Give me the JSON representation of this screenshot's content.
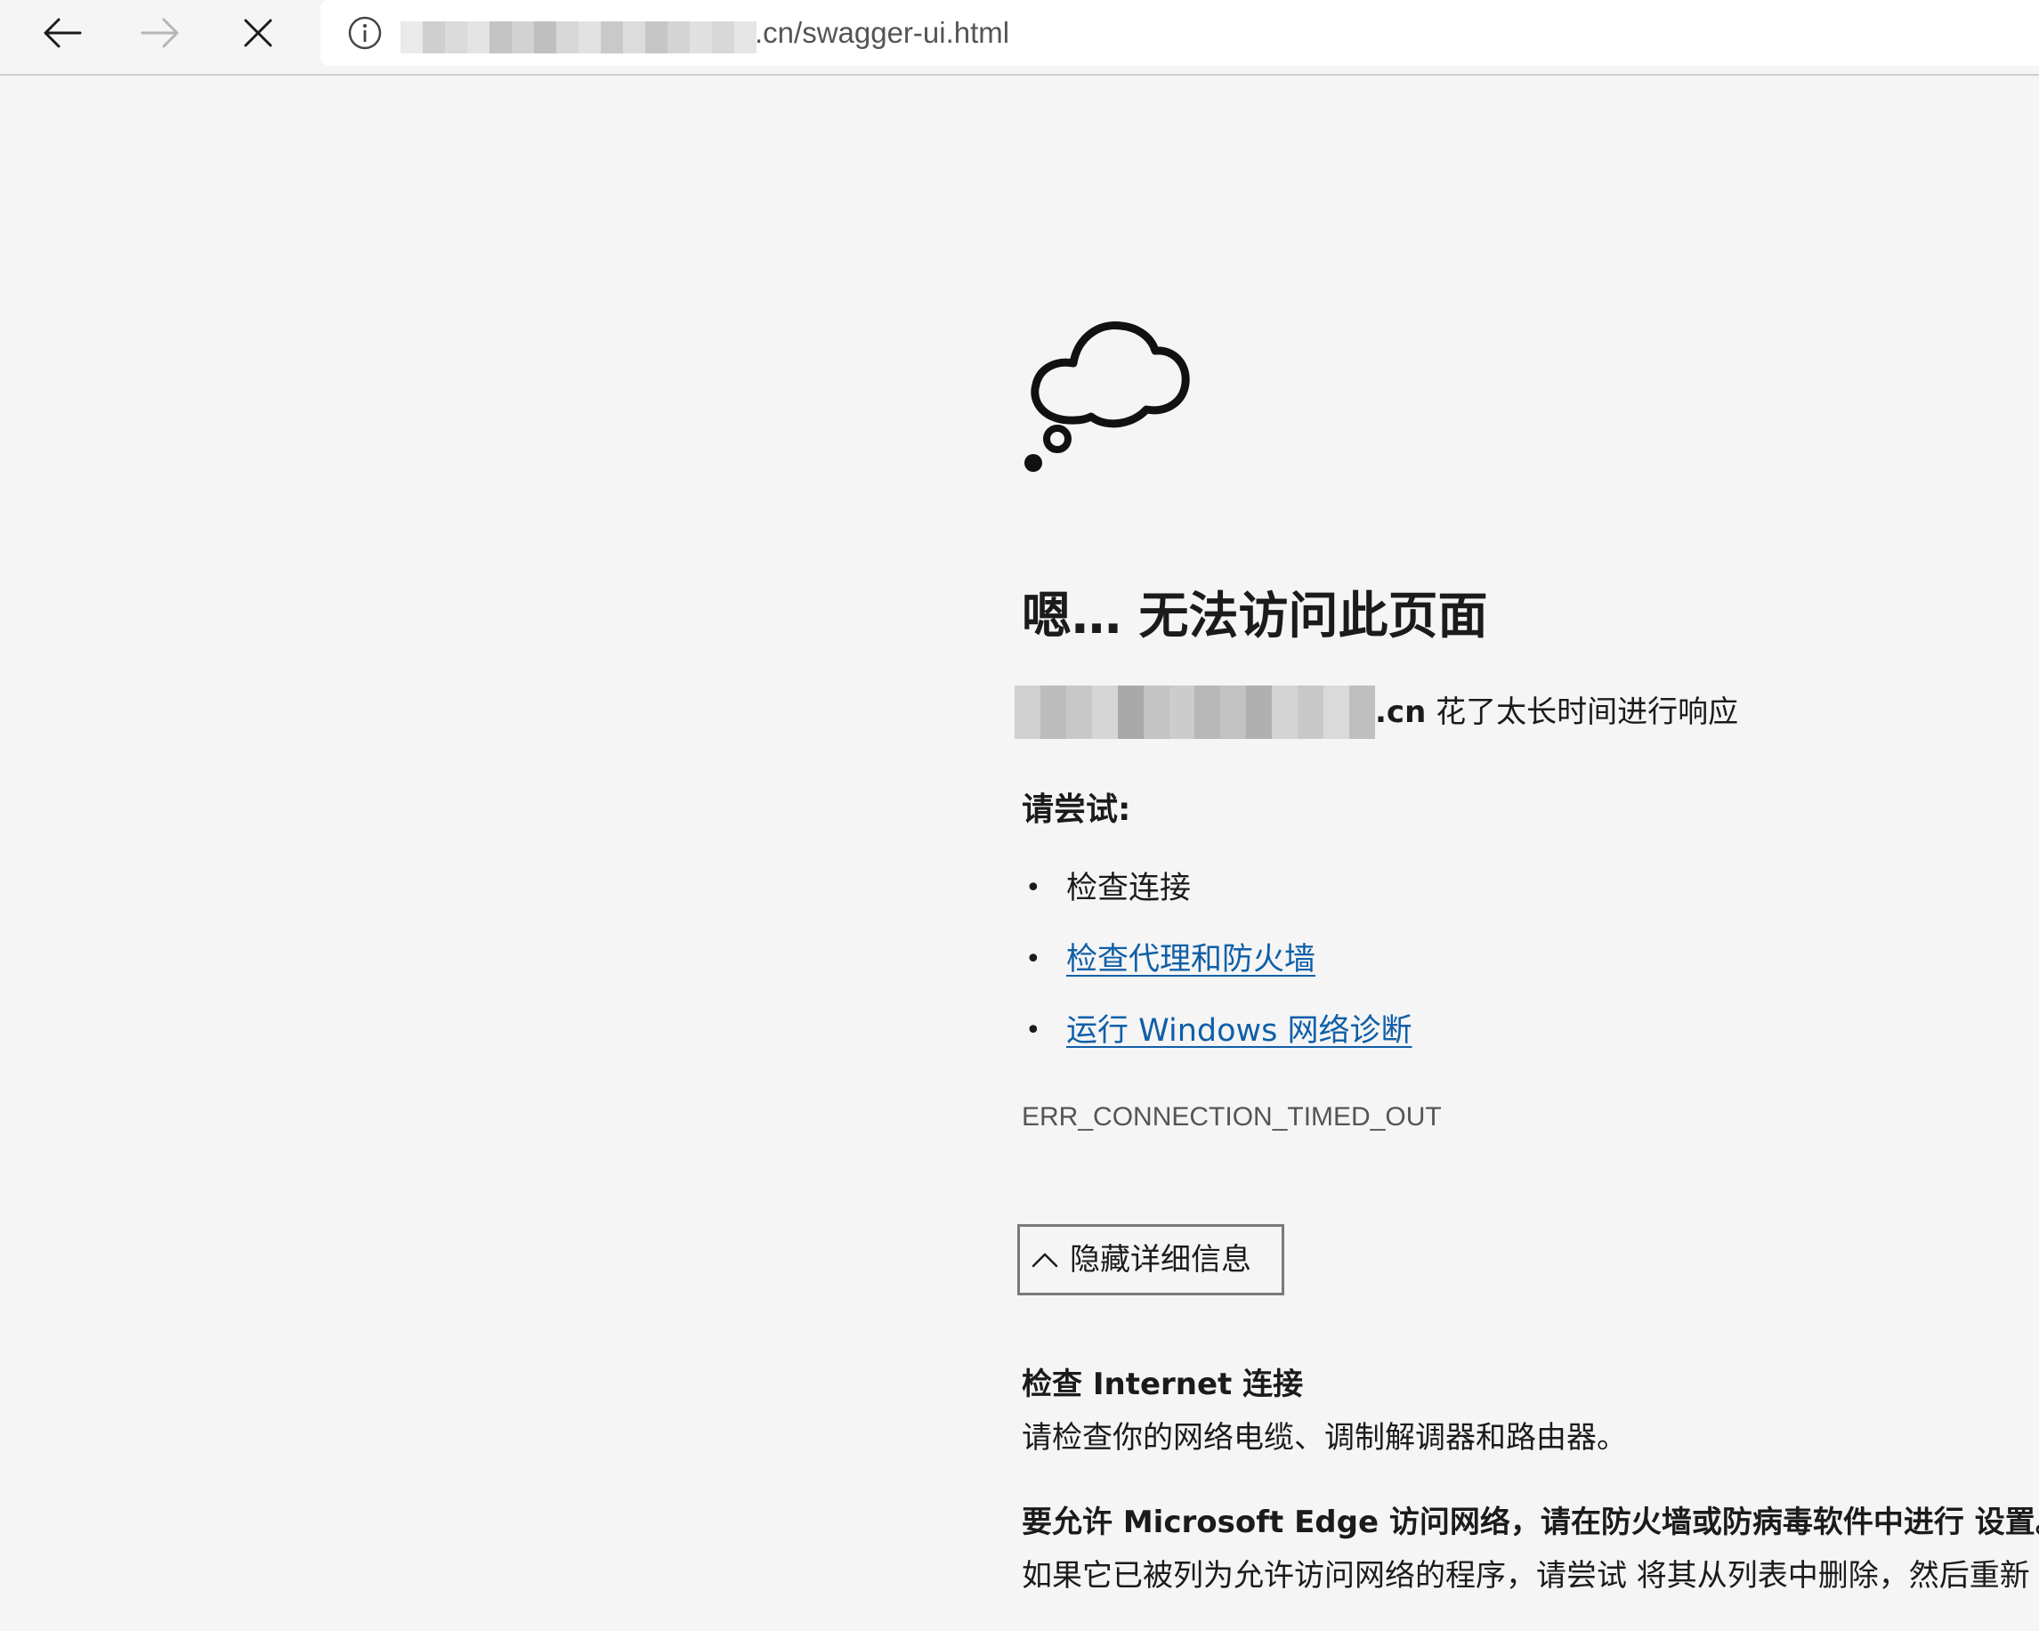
{
  "browser": {
    "back_icon": "arrow-left-icon",
    "forward_icon": "arrow-right-icon",
    "stop_icon": "close-icon",
    "site_info_icon": "info-icon",
    "url_visible": ".cn/swagger-ui.html"
  },
  "error_page": {
    "icon": "thought-cloud-icon",
    "heading": "嗯… 无法访问此页面",
    "site_suffix": ".cn",
    "message": "花了太长时间进行响应",
    "try_label": "请尝试:",
    "suggestions": [
      {
        "text": "检查连接",
        "is_link": false
      },
      {
        "text": "检查代理和防火墙",
        "is_link": true
      },
      {
        "text": "运行 Windows 网络诊断",
        "is_link": true
      }
    ],
    "error_code": "ERR_CONNECTION_TIMED_OUT",
    "details_button_label": "隐藏详细信息",
    "details_button_icon": "chevron-up-icon",
    "details": [
      {
        "title": "检查 Internet 连接",
        "text": "请检查你的网络电缆、调制解调器和路由器。"
      },
      {
        "title": "要允许 Microsoft Edge 访问网络，请在防火墙或防病毒软件中进行 设置。",
        "text": "如果它已被列为允许访问网络的程序，请尝试 将其从列表中删除，然后重新"
      }
    ]
  },
  "colors": {
    "background": "#f5f5f5",
    "link": "#0f5fa8",
    "text": "#1b1b1b",
    "muted": "#555555"
  }
}
